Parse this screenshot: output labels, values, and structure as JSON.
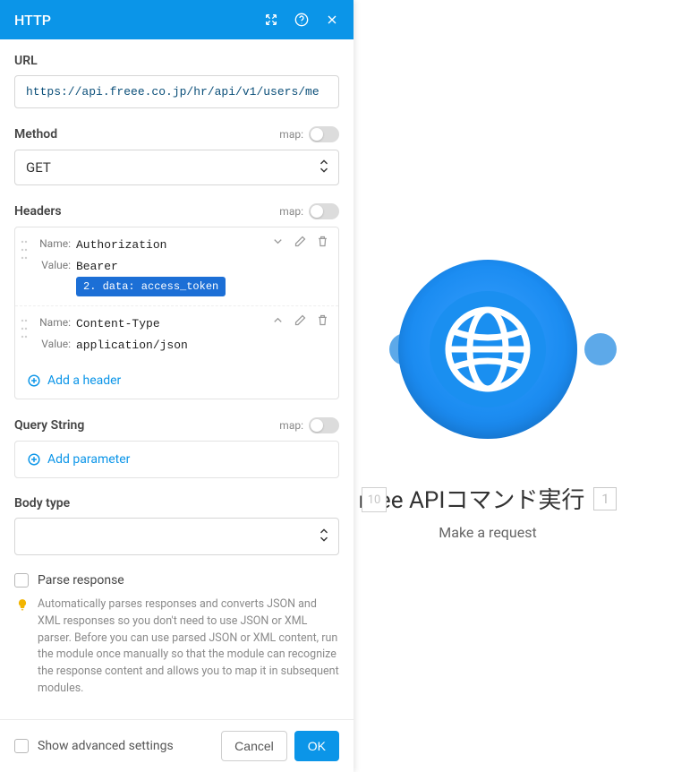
{
  "panel": {
    "title": "HTTP",
    "url_label": "URL",
    "url_value": "https://api.freee.co.jp/hr/api/v1/users/me",
    "method_label": "Method",
    "method_value": "GET",
    "map_label": "map:",
    "headers_label": "Headers",
    "headers": [
      {
        "name_label": "Name:",
        "name_value": "Authorization",
        "value_label": "Value:",
        "value_prefix": "Bearer",
        "pill": "2. data: access_token",
        "chevron": "down"
      },
      {
        "name_label": "Name:",
        "name_value": "Content-Type",
        "value_label": "Value:",
        "value_prefix": "application/json",
        "pill": "",
        "chevron": "up"
      }
    ],
    "add_header": "Add a header",
    "query_label": "Query String",
    "add_parameter": "Add parameter",
    "body_type_label": "Body type",
    "body_type_value": "",
    "parse_response_label": "Parse response",
    "parse_hint": "Automatically parses responses and converts JSON and XML responses so you don't need to use JSON or XML parser. Before you can use parsed JSON or XML content, run the module once manually so that the module can recognize the response content and allows you to map it in subsequent modules.",
    "advanced_label": "Show advanced settings",
    "cancel": "Cancel",
    "ok": "OK"
  },
  "node": {
    "title": "reee APIコマンド実行",
    "badge": "1",
    "left_badge": "10",
    "subtitle": "Make a request"
  }
}
